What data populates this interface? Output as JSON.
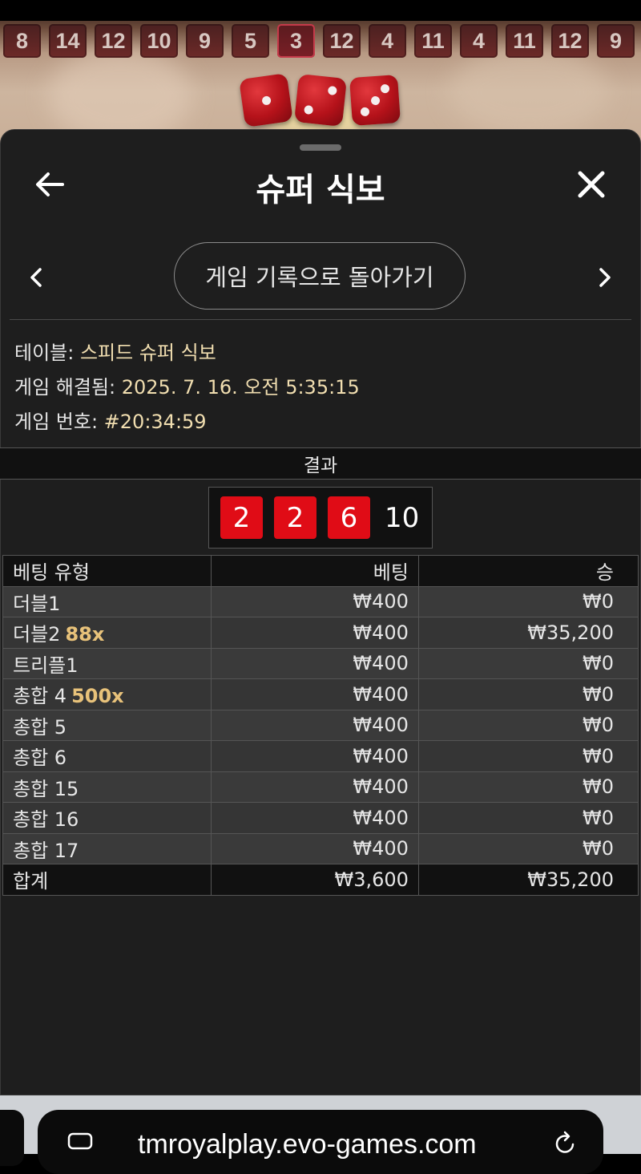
{
  "game": {
    "history": [
      "8",
      "14",
      "12",
      "10",
      "9",
      "5",
      "3",
      "12",
      "4",
      "11",
      "4",
      "11",
      "12",
      "9"
    ],
    "highlighted_history_index": 6,
    "dice_faces": [
      1,
      2,
      3
    ]
  },
  "sheet": {
    "title": "슈퍼 식보",
    "back_icon": "arrow-left-icon",
    "close_icon": "close-icon",
    "back_to_history_label": "게임 기록으로 돌아가기",
    "prev_icon": "chevron-left-icon",
    "next_icon": "chevron-right-icon"
  },
  "info": {
    "table_label": "테이블: ",
    "table_value": "스피드 슈퍼 식보",
    "resolved_label": "게임 해결됨: ",
    "resolved_value": "2025. 7. 16. 오전 5:35:15",
    "game_no_label": "게임 번호: ",
    "game_no_value": "#20:34:59"
  },
  "result": {
    "header": "결과",
    "dice": [
      "2",
      "2",
      "6"
    ],
    "total": "10"
  },
  "bets": {
    "headers": {
      "type": "베팅 유형",
      "bet": "베팅",
      "win": "승"
    },
    "rows": [
      {
        "type": "더블1",
        "mult": "",
        "bet": "₩400",
        "win": "₩0"
      },
      {
        "type": "더블2",
        "mult": "88x",
        "bet": "₩400",
        "win": "₩35,200"
      },
      {
        "type": "트리플1",
        "mult": "",
        "bet": "₩400",
        "win": "₩0"
      },
      {
        "type": "총합 4",
        "mult": "500x",
        "bet": "₩400",
        "win": "₩0"
      },
      {
        "type": "총합 5",
        "mult": "",
        "bet": "₩400",
        "win": "₩0"
      },
      {
        "type": "총합 6",
        "mult": "",
        "bet": "₩400",
        "win": "₩0"
      },
      {
        "type": "총합 15",
        "mult": "",
        "bet": "₩400",
        "win": "₩0"
      },
      {
        "type": "총합 16",
        "mult": "",
        "bet": "₩400",
        "win": "₩0"
      },
      {
        "type": "총합 17",
        "mult": "",
        "bet": "₩400",
        "win": "₩0"
      }
    ],
    "total": {
      "type": "합계",
      "bet": "₩3,600",
      "win": "₩35,200"
    }
  },
  "browser": {
    "url": "tmroyalplay.evo-games.com",
    "tabs_icon": "tabs-icon",
    "reload_icon": "reload-icon"
  },
  "colors": {
    "accent_red": "#e00c16",
    "multiplier_gold": "#e8c27a",
    "info_value": "#f1deb0"
  }
}
